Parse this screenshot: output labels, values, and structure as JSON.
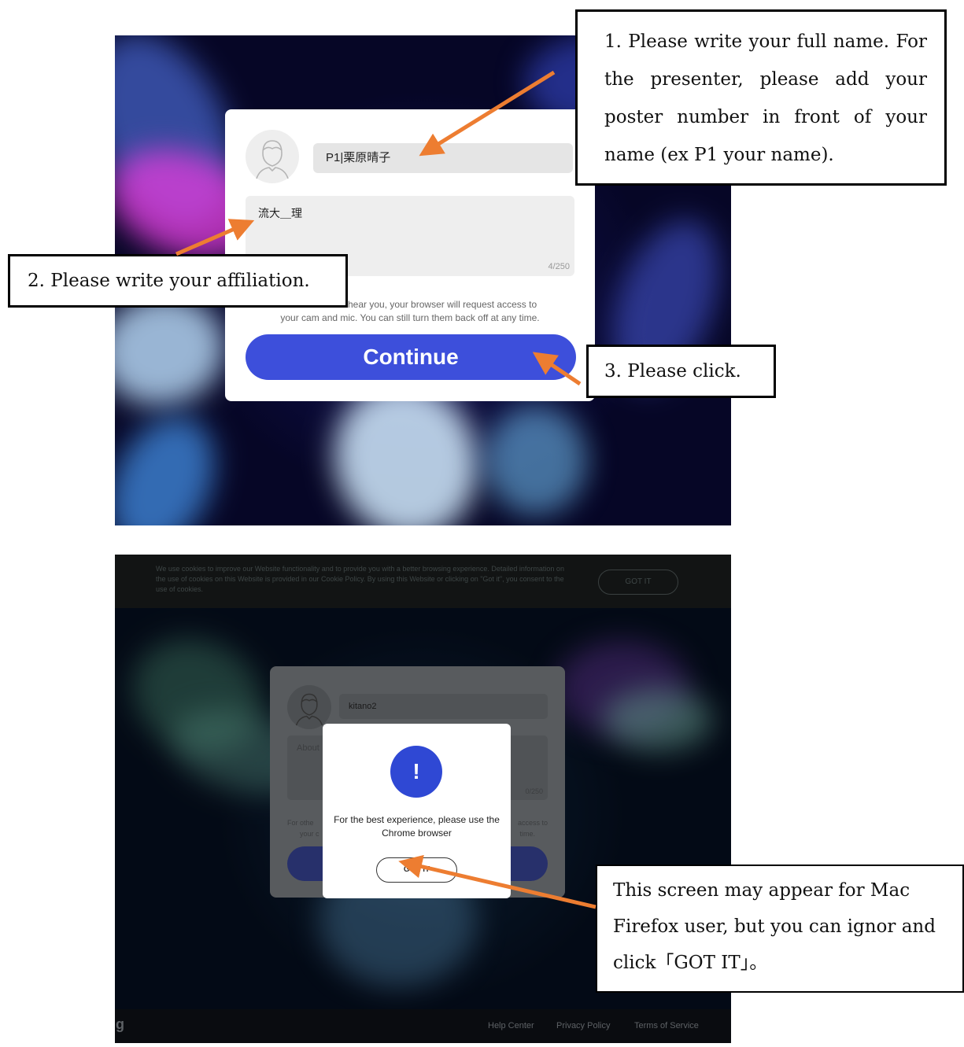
{
  "panel1": {
    "name_value": "P1|栗原晴子",
    "about_value": "流大＿理",
    "about_counter": "4/250",
    "notice_line1": "d hear you, your browser will request access to",
    "notice_line2": "your cam and mic. You can still turn them back off at any time.",
    "continue_label": "Continue"
  },
  "panel2": {
    "cookie_text": "We use cookies to improve our Website functionality and to provide you with a better browsing experience. Detailed information on the use of cookies on this Website is provided in our Cookie Policy. By using this Website or clicking on \"Got it\", you consent to the use of cookies.",
    "cookie_button": "GOT IT",
    "name_value": "kitano2",
    "about_placeholder": "About",
    "about_counter": "0/250",
    "notice_left": "For othe",
    "notice_left2": "your c",
    "notice_right": "access to",
    "notice_right2": "time.",
    "modal_icon": "!",
    "modal_text": "For the best experience, please use the Chrome browser",
    "modal_button": "GOT IT",
    "footer_logo": "ig",
    "footer_links": [
      "Help Center",
      "Privacy Policy",
      "Terms of Service"
    ]
  },
  "callouts": {
    "step1": "1.  Please write your full name. For the presenter, please add your poster number in front of your name (ex P1 your name).",
    "step2": "2.  Please write your affiliation.",
    "step3": "3.  Please click.",
    "note": "This screen may appear for Mac Firefox user, but you can ignor and click「GOT IT」。"
  },
  "colors": {
    "arrow": "#ed7d31",
    "continue_button": "#3d4fdb",
    "modal_icon": "#2f48d4"
  },
  "icons": [
    "user-avatar-icon",
    "exclamation-icon"
  ]
}
